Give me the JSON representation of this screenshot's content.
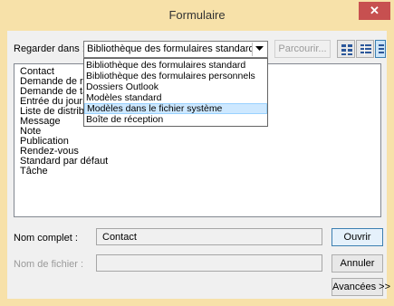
{
  "window": {
    "title": "Formulaire",
    "close_glyph": "✕"
  },
  "lookin": {
    "label": "Regarder dans :",
    "selected": "Bibliothèque des formulaires standard",
    "browse_label": "Parcourir..."
  },
  "dropdown": {
    "options": [
      "Bibliothèque des formulaires standard",
      "Bibliothèque des formulaires personnels",
      "Dossiers Outlook",
      "Modèles standard",
      "Modèles dans le fichier système",
      "Boîte de réception"
    ],
    "highlighted": "Modèles dans le fichier système"
  },
  "list": {
    "items": [
      "Contact",
      "Demande de réunion",
      "Demande de tâche",
      "Entrée du journal",
      "Liste de distribution",
      "Message",
      "Note",
      "Publication",
      "Rendez-vous",
      "Standard par défaut",
      "Tâche"
    ]
  },
  "details": {
    "fullname_label": "Nom complet :",
    "fullname_value": "Contact",
    "filename_label": "Nom de fichier :",
    "filename_value": ""
  },
  "buttons": {
    "open": "Ouvrir",
    "cancel": "Annuler",
    "advanced": "Avancées >>"
  },
  "icons": {
    "close": "close-icon",
    "dropdown_arrow": "chevron-down-icon",
    "view_large": "large-icons-view-icon",
    "view_small": "small-icons-view-icon",
    "view_details": "details-view-icon"
  },
  "colors": {
    "titlebar": "#f7e1a9",
    "close": "#c75050",
    "highlight": "#cde8ff"
  }
}
